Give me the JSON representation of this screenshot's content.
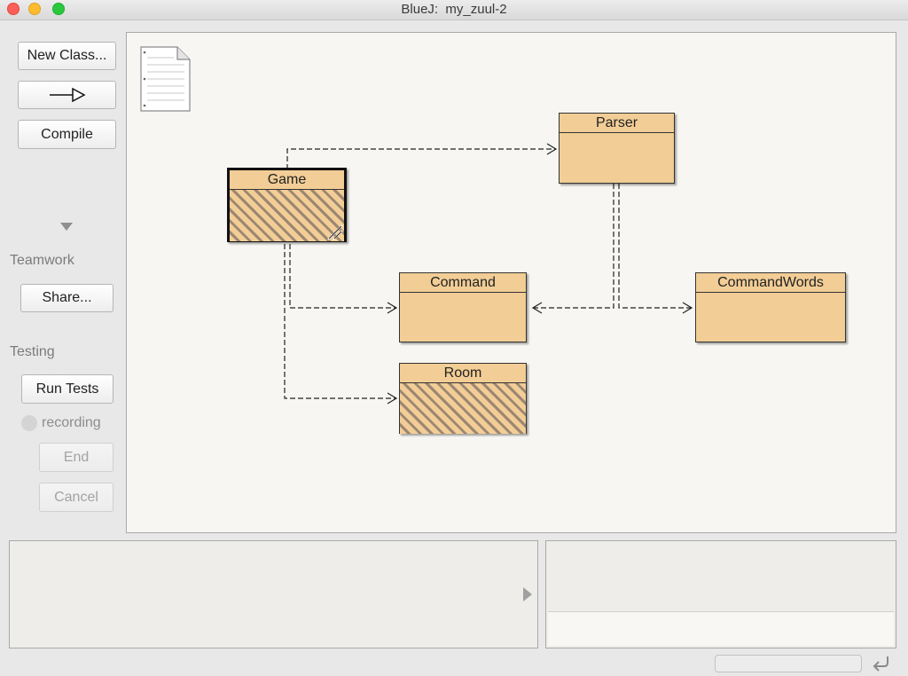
{
  "window": {
    "title": "BlueJ:  my_zuul-2"
  },
  "toolbar": {
    "new_class": "New Class...",
    "compile": "Compile"
  },
  "sidebar": {
    "teamwork_label": "Teamwork",
    "share": "Share...",
    "testing_label": "Testing",
    "run_tests": "Run Tests",
    "recording": "recording",
    "end": "End",
    "cancel": "Cancel"
  },
  "diagram": {
    "classes": [
      {
        "name": "Game",
        "selected": true,
        "needs_compile": true
      },
      {
        "name": "Parser",
        "selected": false,
        "needs_compile": false
      },
      {
        "name": "Command",
        "selected": false,
        "needs_compile": false
      },
      {
        "name": "CommandWords",
        "selected": false,
        "needs_compile": false
      },
      {
        "name": "Room",
        "selected": false,
        "needs_compile": true
      }
    ],
    "dependencies": [
      {
        "from": "Game",
        "to": "Parser"
      },
      {
        "from": "Game",
        "to": "Command"
      },
      {
        "from": "Game",
        "to": "Room"
      },
      {
        "from": "Parser",
        "to": "Command"
      },
      {
        "from": "Parser",
        "to": "CommandWords"
      }
    ]
  },
  "icons": {
    "readme": "readme-document-icon",
    "arrow": "inheritance-arrow-icon",
    "collapse": "triangle-down-icon",
    "expand": "triangle-right-icon",
    "recording_dot": "record-indicator-icon",
    "wrap": "return-arrow-icon"
  },
  "colors": {
    "class_fill": "#f2cd96",
    "class_hatch": "#9c8772",
    "canvas": "#f7f6f2"
  }
}
